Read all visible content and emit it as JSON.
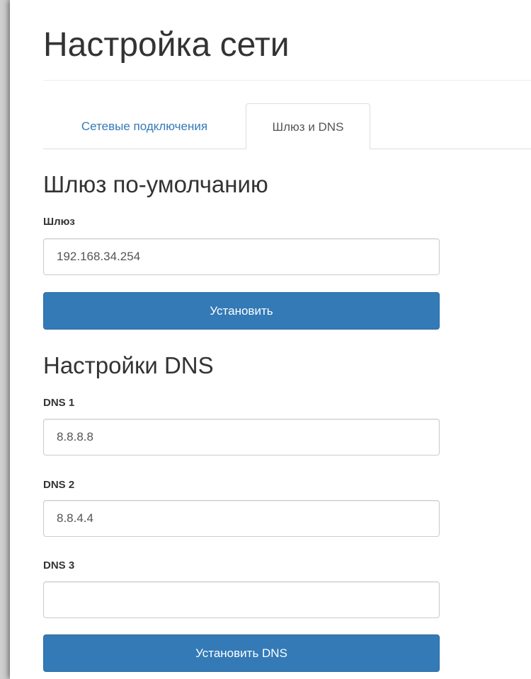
{
  "page": {
    "title": "Настройка сети"
  },
  "tabs": [
    {
      "label": "Сетевые подключения",
      "active": false
    },
    {
      "label": "Шлюз и DNS",
      "active": true
    }
  ],
  "gateway": {
    "heading": "Шлюз по-умолчанию",
    "field_label": "Шлюз",
    "value": "192.168.34.254",
    "submit_label": "Установить"
  },
  "dns": {
    "heading": "Настройки DNS",
    "fields": [
      {
        "label": "DNS 1",
        "value": "8.8.8.8"
      },
      {
        "label": "DNS 2",
        "value": "8.8.4.4"
      },
      {
        "label": "DNS 3",
        "value": ""
      }
    ],
    "submit_label": "Установить DNS"
  },
  "colors": {
    "primary": "#337ab7",
    "link": "#337ab7",
    "text": "#333333"
  }
}
